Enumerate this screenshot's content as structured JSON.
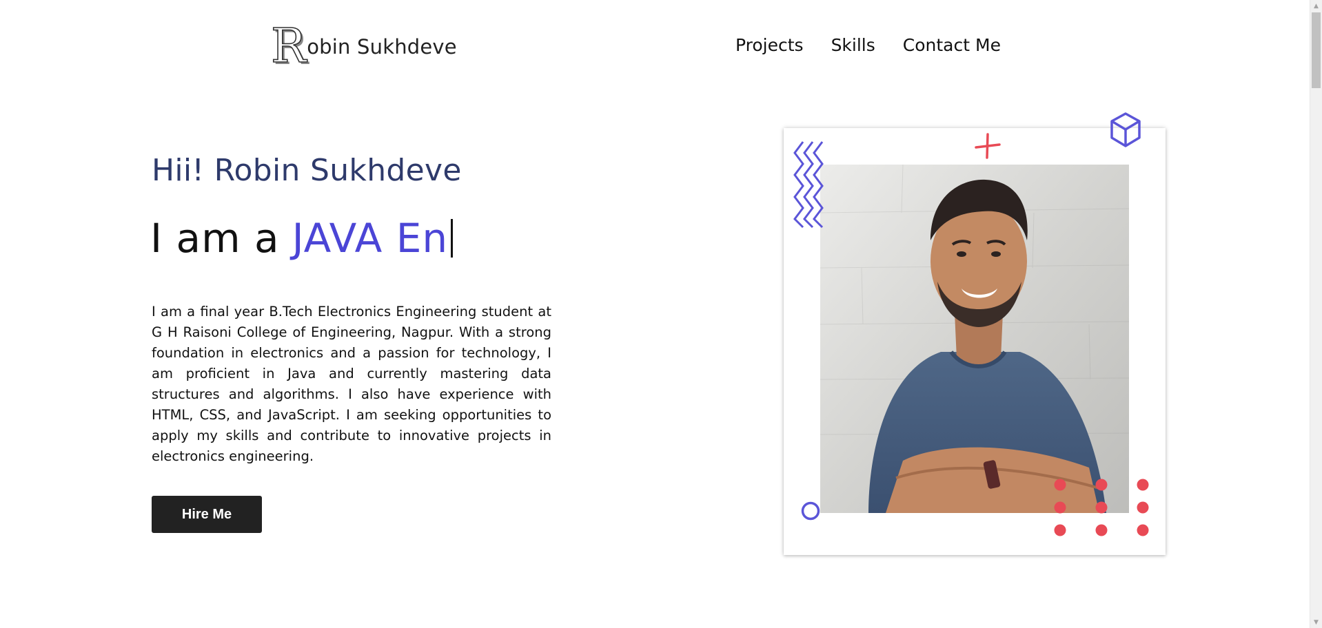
{
  "header": {
    "logo_letter": "R",
    "logo_text": "obin Sukhdeve",
    "nav": [
      {
        "label": "Projects"
      },
      {
        "label": "Skills"
      },
      {
        "label": "Contact Me"
      }
    ]
  },
  "hero": {
    "greeting": "Hii! Robin Sukhdeve",
    "role_prefix": "I am a",
    "role_typed": "JAVA En",
    "bio": "I am a final year B.Tech Electronics Engineering student at G H Raisoni College of Engineering, Nagpur. With a strong foundation in electronics and a passion for technology, I am proficient in Java and currently mastering data structures and algorithms. I also have experience with HTML, CSS, and JavaScript. I am seeking opportunities to apply my skills and contribute to innovative projects in electronics engineering.",
    "cta_label": "Hire Me"
  },
  "colors": {
    "accent": "#4b45d6",
    "greeting": "#2e3a6b",
    "button": "#222222",
    "deco_red": "#e84a55",
    "deco_blue": "#5b55d8"
  },
  "icons": {
    "zigzag": "zigzag-lines-icon",
    "cross": "cross-icon",
    "cube": "cube-icon",
    "ring": "circle-icon",
    "dots": "dot-grid-icon"
  }
}
